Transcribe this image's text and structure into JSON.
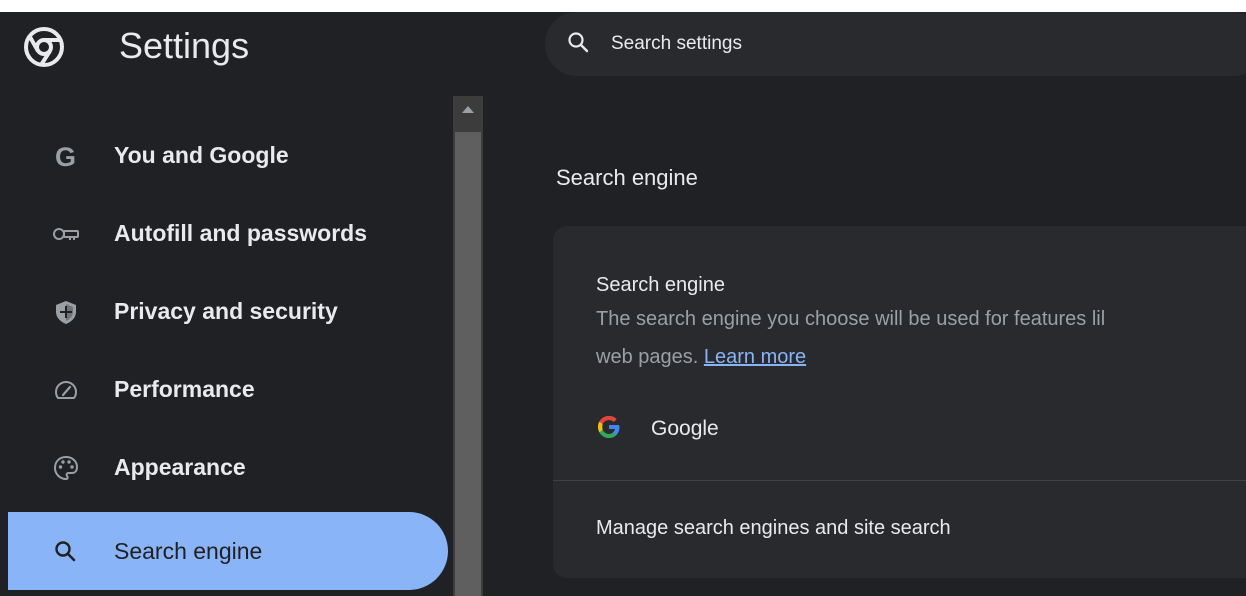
{
  "header": {
    "title": "Settings",
    "logo_icon": "chrome-logo-icon",
    "search": {
      "placeholder": "Search settings",
      "icon": "search-icon"
    }
  },
  "sidebar": {
    "items": [
      {
        "label": "You and Google",
        "icon": "google-g-icon",
        "active": false
      },
      {
        "label": "Autofill and passwords",
        "icon": "key-icon",
        "active": false
      },
      {
        "label": "Privacy and security",
        "icon": "shield-icon",
        "active": false
      },
      {
        "label": "Performance",
        "icon": "speedometer-icon",
        "active": false
      },
      {
        "label": "Appearance",
        "icon": "palette-icon",
        "active": false
      },
      {
        "label": "Search engine",
        "icon": "search-icon",
        "active": true
      }
    ]
  },
  "main": {
    "section_title": "Search engine",
    "card": {
      "title": "Search engine",
      "description": "The search engine you choose will be used for features like searching from the address bar and from images in web pages.",
      "description_visible_line1": "The search engine you choose will be used for features lil",
      "description_visible_line2": "web pages.",
      "learn_more": "Learn more",
      "selected_engine": "Google",
      "selected_engine_icon": "google-color-g-icon",
      "manage_label": "Manage search engines and site search"
    }
  },
  "colors": {
    "background": "#202124",
    "surface": "#292a2d",
    "text_primary": "#e8eaed",
    "text_secondary": "#9aa0a6",
    "accent": "#8ab4f8"
  }
}
